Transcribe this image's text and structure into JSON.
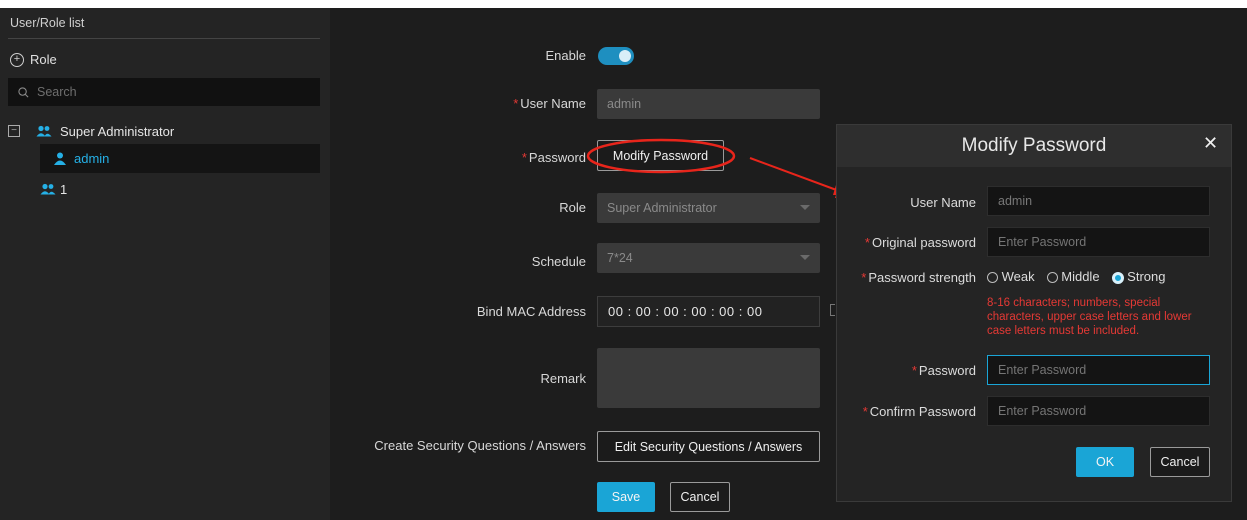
{
  "sidebar": {
    "title": "User/Role list",
    "role_button": "Role",
    "search_placeholder": "Search",
    "tree": {
      "group_label": "Super Administrator",
      "selected_user": "admin",
      "second_group": "1"
    }
  },
  "form": {
    "enable_label": "Enable",
    "enable_state": true,
    "user_name_label": "User Name",
    "user_name_value": "admin",
    "password_label": "Password",
    "modify_password_button": "Modify Password",
    "role_label": "Role",
    "role_value": "Super Administrator",
    "schedule_label": "Schedule",
    "schedule_value": "7*24",
    "mac_label": "Bind MAC Address",
    "mac_value": "00 : 00 : 00 : 00 : 00 : 00",
    "remark_label": "Remark",
    "remark_value": "",
    "security_label": "Create Security Questions / Answers",
    "security_button": "Edit Security Questions / Answers",
    "save_button": "Save",
    "cancel_button": "Cancel"
  },
  "modal": {
    "title": "Modify Password",
    "close_glyph": "✕",
    "user_name_label": "User Name",
    "user_name_value": "admin",
    "original_password_label": "Original password",
    "original_password_placeholder": "Enter Password",
    "strength_label": "Password strength",
    "strength_options": [
      "Weak",
      "Middle",
      "Strong"
    ],
    "strength_selected": "Strong",
    "strength_hint": "8-16 characters; numbers, special characters, upper case letters and lower case letters must be included.",
    "password_label": "Password",
    "password_placeholder": "Enter Password",
    "confirm_label": "Confirm Password",
    "confirm_placeholder": "Enter Password",
    "ok_button": "OK",
    "cancel_button": "Cancel"
  },
  "colors": {
    "accent": "#1aa5d6",
    "required": "#e53935",
    "annotation": "#e8251b"
  },
  "icons": {
    "role_add": "circle-plus-icon",
    "search": "search-icon",
    "group": "users-icon",
    "user": "user-icon",
    "collapse": "collapse-minus-icon"
  }
}
